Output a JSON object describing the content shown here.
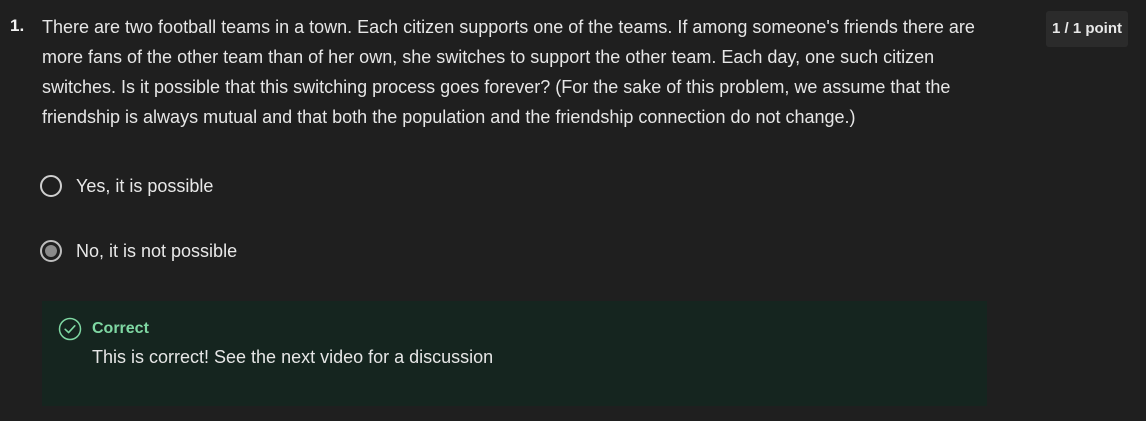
{
  "question": {
    "number": "1.",
    "text": "There are two football teams in a town. Each citizen supports one of the teams. If among someone's friends there are more fans of the other team than of her own, she switches to support the other team. Each day, one such citizen switches. Is it possible that this switching process goes forever? (For the sake of this problem, we assume that the friendship is always mutual and that both the population and the friendship connection do not change.)",
    "points": "1 / 1 point"
  },
  "options": [
    {
      "label": "Yes, it is possible",
      "selected": false
    },
    {
      "label": "No, it is not possible",
      "selected": true
    }
  ],
  "feedback": {
    "status": "Correct",
    "message": "This is correct! See the next video for a discussion",
    "icon": "check-circle-icon",
    "accent_color": "#7fd8a3"
  },
  "colors": {
    "background": "#1f1f1f",
    "feedback_background": "#15251f"
  }
}
